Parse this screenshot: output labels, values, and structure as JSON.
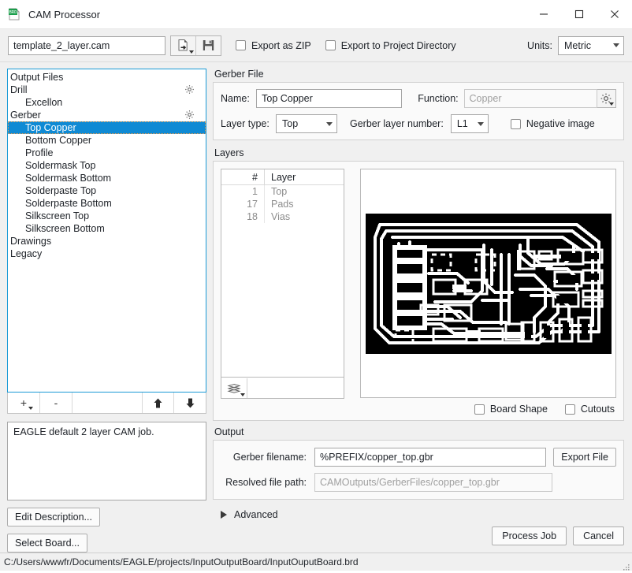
{
  "window": {
    "title": "CAM Processor",
    "icon": "brd-file-icon",
    "minimize": "minimize-icon",
    "maximize": "maximize-icon",
    "close": "close-icon"
  },
  "toolbar": {
    "cam_file_value": "template_2_layer.cam",
    "cam_file_placeholder": "",
    "load_icon": "open-file-icon",
    "save_icon": "save-floppy-icon",
    "export_zip_label": "Export as ZIP",
    "export_zip_checked": false,
    "export_project_dir_label": "Export to Project Directory",
    "export_project_dir_checked": false,
    "units_label": "Units:",
    "units_value": "Metric"
  },
  "tree": {
    "nodes": [
      {
        "label": "Output Files",
        "level": 0,
        "gear": false,
        "selected": false
      },
      {
        "label": "Drill",
        "level": 0,
        "gear": true,
        "selected": false
      },
      {
        "label": "Excellon",
        "level": 1,
        "gear": false,
        "selected": false
      },
      {
        "label": "Gerber",
        "level": 0,
        "gear": true,
        "selected": false
      },
      {
        "label": "Top Copper",
        "level": 1,
        "gear": false,
        "selected": true
      },
      {
        "label": "Bottom Copper",
        "level": 1,
        "gear": false,
        "selected": false
      },
      {
        "label": "Profile",
        "level": 1,
        "gear": false,
        "selected": false
      },
      {
        "label": "Soldermask Top",
        "level": 1,
        "gear": false,
        "selected": false
      },
      {
        "label": "Soldermask Bottom",
        "level": 1,
        "gear": false,
        "selected": false
      },
      {
        "label": "Solderpaste Top",
        "level": 1,
        "gear": false,
        "selected": false
      },
      {
        "label": "Solderpaste Bottom",
        "level": 1,
        "gear": false,
        "selected": false
      },
      {
        "label": "Silkscreen Top",
        "level": 1,
        "gear": false,
        "selected": false
      },
      {
        "label": "Silkscreen Bottom",
        "level": 1,
        "gear": false,
        "selected": false
      },
      {
        "label": "Drawings",
        "level": 0,
        "gear": false,
        "selected": false
      },
      {
        "label": "Legacy",
        "level": 0,
        "gear": false,
        "selected": false
      }
    ],
    "toolbar": {
      "add_label": "+",
      "remove_label": "-",
      "move_up_icon": "arrow-up-icon",
      "move_down_icon": "arrow-down-icon"
    }
  },
  "description": {
    "text": "EAGLE default 2 layer CAM job.",
    "edit_button": "Edit Description...",
    "select_board_button": "Select Board..."
  },
  "gerber_file": {
    "group_title": "Gerber File",
    "name_label": "Name:",
    "name_value": "Top Copper",
    "function_label": "Function:",
    "function_placeholder": "Copper",
    "function_value": "",
    "function_gear_icon": "gear-icon",
    "layer_type_label": "Layer type:",
    "layer_type_value": "Top",
    "gerber_layer_number_label": "Gerber layer number:",
    "gerber_layer_number_value": "L1",
    "negative_image_label": "Negative image",
    "negative_image_checked": false
  },
  "layers": {
    "group_title": "Layers",
    "columns": [
      "#",
      "Layer"
    ],
    "rows": [
      {
        "num": "1",
        "layer": "Top"
      },
      {
        "num": "17",
        "layer": "Pads"
      },
      {
        "num": "18",
        "layer": "Vias"
      }
    ],
    "stack_icon": "layers-stack-icon"
  },
  "preview": {
    "board_shape_label": "Board Shape",
    "board_shape_checked": false,
    "cutouts_label": "Cutouts",
    "cutouts_checked": false
  },
  "output": {
    "group_title": "Output",
    "gerber_filename_label": "Gerber filename:",
    "gerber_filename_value": "%PREFIX/copper_top.gbr",
    "export_file_button": "Export File",
    "resolved_path_label": "Resolved file path:",
    "resolved_path_value": "CAMOutputs/GerberFiles/copper_top.gbr"
  },
  "advanced": {
    "label": "Advanced",
    "expander_icon": "chevron-right-icon",
    "expanded": false
  },
  "actions": {
    "process_job": "Process Job",
    "cancel": "Cancel"
  },
  "statusbar": {
    "path": "C:/Users/wwwfr/Documents/EAGLE/projects/InputOutputBoard/InputOuputBoard.brd"
  },
  "colors": {
    "selection_blue": "#0f8ad4",
    "focus_border": "#1a9ad6",
    "window_bg": "#f0f0f0",
    "field_bg": "#ffffff",
    "pcb_black": "#000000",
    "pcb_white": "#ffffff"
  }
}
